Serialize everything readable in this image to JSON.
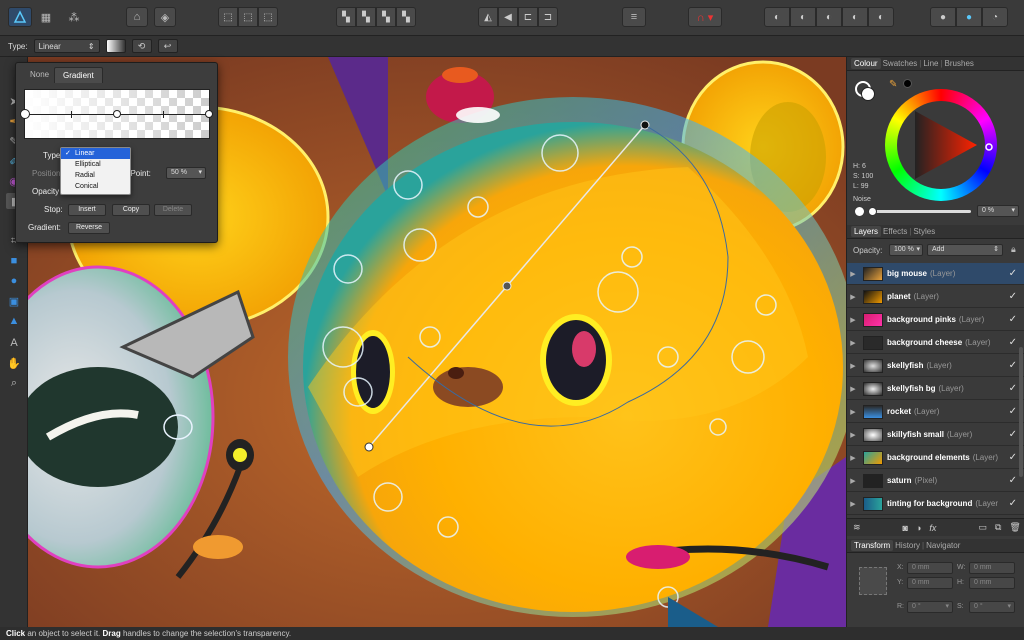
{
  "context_bar": {
    "type_label": "Type:",
    "type_value": "Linear"
  },
  "gradient_popup": {
    "tabs": [
      "None",
      "Gradient"
    ],
    "type_label": "Type",
    "position_label": "Position",
    "midpoint_label": "id Point:",
    "midpoint_value": "50 %",
    "opacity_label": "Opacity",
    "stop_label": "Stop:",
    "insert_label": "Insert",
    "copy_label": "Copy",
    "delete_label": "Delete",
    "gradient_label": "Gradient:",
    "reverse_label": "Reverse",
    "type_options": [
      "Linear",
      "Elliptical",
      "Radial",
      "Conical"
    ],
    "selected_type": "Linear"
  },
  "colour_panel": {
    "tabs": [
      "Colour",
      "Swatches",
      "Line",
      "Brushes"
    ],
    "h": "H: 6",
    "s": "S: 100",
    "l": "L: 99",
    "noise_label": "Noise",
    "noise_value": "0 %"
  },
  "layers_panel": {
    "tabs": [
      "Layers",
      "Effects",
      "Styles"
    ],
    "opacity_label": "Opacity:",
    "opacity_value": "100 %",
    "blend_mode": "Add",
    "layers": [
      {
        "name": "big mouse",
        "kind": "(Layer)"
      },
      {
        "name": "planet",
        "kind": "(Layer)"
      },
      {
        "name": "background pinks",
        "kind": "(Layer)"
      },
      {
        "name": "background cheese",
        "kind": "(Layer)"
      },
      {
        "name": "skellyfish",
        "kind": "(Layer)"
      },
      {
        "name": "skellyfish bg",
        "kind": "(Layer)"
      },
      {
        "name": "rocket",
        "kind": "(Layer)"
      },
      {
        "name": "skillyfish small",
        "kind": "(Layer)"
      },
      {
        "name": "background elements",
        "kind": "(Layer)"
      },
      {
        "name": "saturn",
        "kind": "(Pixel)"
      },
      {
        "name": "tinting for background",
        "kind": "(Layer"
      }
    ]
  },
  "transform_panel": {
    "tabs": [
      "Transform",
      "History",
      "Navigator"
    ],
    "x_label": "X:",
    "x_value": "0 mm",
    "y_label": "Y:",
    "y_value": "0 mm",
    "w_label": "W:",
    "w_value": "0 mm",
    "h_label": "H:",
    "h_value": "0 mm",
    "r_label": "R:",
    "r_value": "0 °",
    "s_label": "S:",
    "s_value": "0 °"
  },
  "status": {
    "click": "Click",
    "text1": " an object to select it. ",
    "drag": "Drag",
    "text2": " handles to change the selection's transparency."
  },
  "colors": {
    "accent_blue": "#2563d9",
    "selected_layer": "#2f4a6a"
  }
}
